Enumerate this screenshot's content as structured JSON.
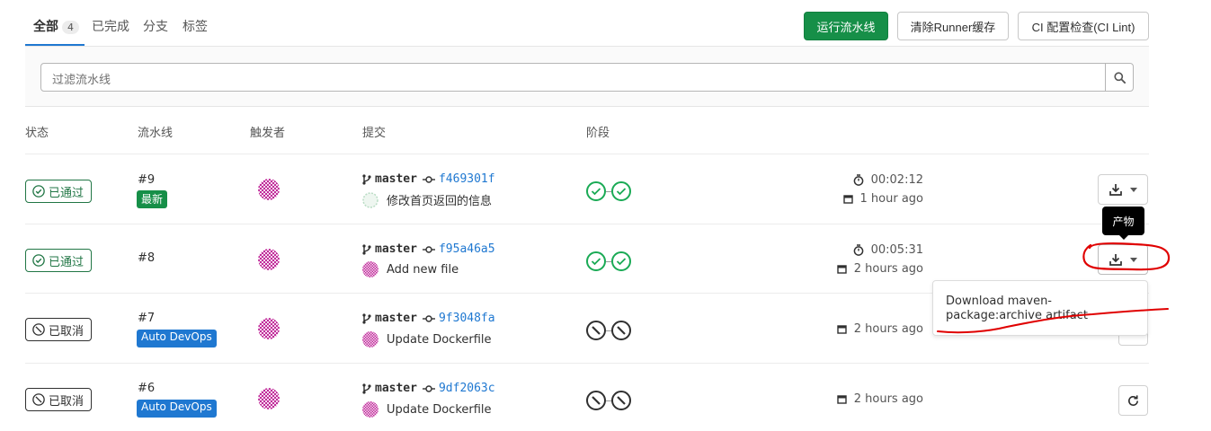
{
  "tabs": [
    {
      "label": "全部",
      "count": "4",
      "active": true
    },
    {
      "label": "已完成"
    },
    {
      "label": "分支"
    },
    {
      "label": "标签"
    }
  ],
  "actions": {
    "run_pipeline": "运行流水线",
    "clear_cache": "清除Runner缓存",
    "ci_lint": "CI 配置检查(CI Lint)"
  },
  "filter": {
    "placeholder": "过滤流水线",
    "icon": "search-icon"
  },
  "columns": {
    "status": "状态",
    "pipeline": "流水线",
    "triggerer": "触发者",
    "commit": "提交",
    "stages": "阶段"
  },
  "colors": {
    "accent": "#1f78d1",
    "success": "#1aaa55",
    "run_button": "#168f48",
    "annotation": "#e00000"
  },
  "pipelines": [
    {
      "status": "已通过",
      "status_kind": "passed",
      "id": "#9",
      "tag": "最新",
      "branch": "master",
      "sha": "f469301f",
      "message": "修改首页返回的信息",
      "stages": [
        "success",
        "success"
      ],
      "duration": "00:02:12",
      "finished": "1 hour ago",
      "action": "artifacts-download"
    },
    {
      "status": "已通过",
      "status_kind": "passed",
      "id": "#8",
      "branch": "master",
      "sha": "f95a46a5",
      "message": "Add new file",
      "stages": [
        "success",
        "success"
      ],
      "duration": "00:05:31",
      "finished": "2 hours ago",
      "action": "artifacts-download"
    },
    {
      "status": "已取消",
      "status_kind": "canceled",
      "id": "#7",
      "tag": "Auto DevOps",
      "branch": "master",
      "sha": "9f3048fa",
      "message": "Update Dockerfile",
      "stages": [
        "canceled",
        "canceled"
      ],
      "finished": "2 hours ago",
      "action": "retry"
    },
    {
      "status": "已取消",
      "status_kind": "canceled",
      "id": "#6",
      "tag": "Auto DevOps",
      "branch": "master",
      "sha": "9df2063c",
      "message": "Update Dockerfile",
      "stages": [
        "canceled",
        "canceled"
      ],
      "finished": "2 hours ago",
      "action": "retry"
    }
  ],
  "tooltip": "产物",
  "artifact_menu": {
    "item": "Download maven-package:archive artifact"
  }
}
